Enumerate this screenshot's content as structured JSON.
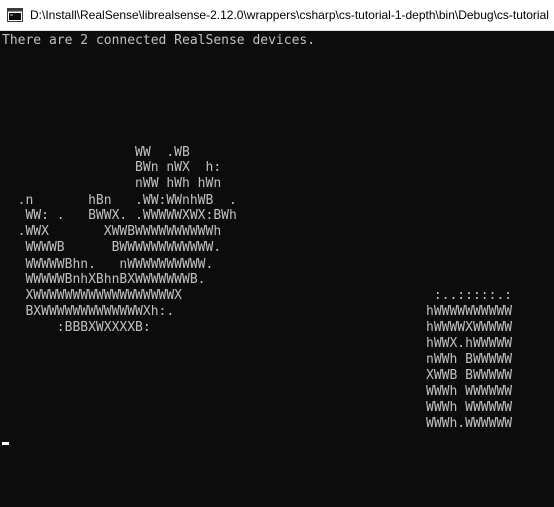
{
  "window": {
    "title": "D:\\Install\\RealSense\\librealsense-2.12.0\\wrappers\\csharp\\cs-tutorial-1-depth\\bin\\Debug\\cs-tutorial",
    "icon": "console-icon"
  },
  "console": {
    "status_line": "There are 2 connected RealSense devices.",
    "left_art": [
      "                 WW  .WB",
      "                 BWn nWX  h:",
      "                 nWW hWh hWn",
      "  .n       hBn   .WW:WWnhWB  .",
      "   WW: .   BWWX. .WWWWWXWX:BWh",
      "  .WWX       XWWBWWWWWWWWWWh",
      "   WWWWB      BWWWWWWWWWWWW.",
      "   WWWWWBhn.   nWWWWWWWWWW.",
      "   WWWWWBnhXBhnBXWWWWWWWB.",
      "   XWWWWWWWWWWWWWWWWWWX",
      "   BXWWWWWWWWWWWWWXh:.",
      "       :BBBXWXXXXB:"
    ],
    "right_art": [
      " :..:::::.:",
      "hWWWWWWWWWW",
      "hWWWWXWWWWW",
      "hWWX.hWWWWW",
      "nWWh BWWWWW",
      "XWWB BWWWWW",
      "WWWh WWWWWW",
      "WWWh WWWWWW",
      "WWWh.WWWWWW"
    ]
  }
}
